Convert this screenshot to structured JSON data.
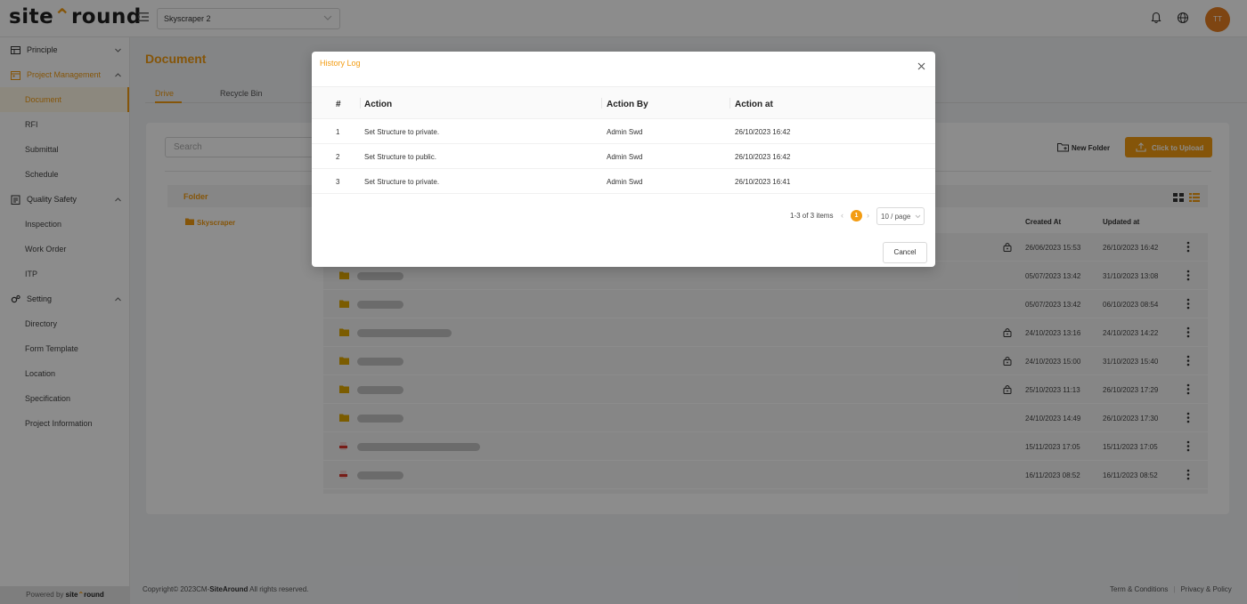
{
  "header": {
    "logo_part1": "site",
    "logo_part2": "round",
    "project": "Skyscraper 2",
    "avatar_initials": "TT"
  },
  "sidebar": {
    "groups": [
      {
        "label": "Principle",
        "icon": "table-icon"
      },
      {
        "label": "Project Management",
        "icon": "calendar-icon",
        "items": [
          "Document",
          "RFI",
          "Submittal",
          "Schedule"
        ]
      },
      {
        "label": "Quality Safety",
        "icon": "clipboard-icon",
        "items": [
          "Inspection",
          "Work Order",
          "ITP"
        ]
      },
      {
        "label": "Setting",
        "icon": "gears-icon",
        "items": [
          "Directory",
          "Form Template",
          "Location",
          "Specification",
          "Project Information"
        ]
      }
    ],
    "selected_item": "Document",
    "powered_by": "Powered by",
    "powered_logo_1": "site",
    "powered_logo_2": "round"
  },
  "page": {
    "title": "Document",
    "tabs": [
      "Drive",
      "Recycle Bin"
    ],
    "active_tab": "Drive"
  },
  "drive": {
    "search_placeholder": "Search",
    "new_folder_label": "New Folder",
    "upload_label": "Click to Upload",
    "folder_header": "Folder",
    "tree_item": "Skyscraper",
    "columns": {
      "created": "Created At",
      "updated": "Updated at"
    },
    "rows": [
      {
        "type": "folder",
        "locked": true,
        "created": "26/06/2023 15:53",
        "updated": "26/10/2023 16:42"
      },
      {
        "type": "folder",
        "locked": false,
        "created": "05/07/2023 13:42",
        "updated": "31/10/2023 13:08"
      },
      {
        "type": "folder",
        "locked": false,
        "created": "05/07/2023 13:42",
        "updated": "06/10/2023 08:54"
      },
      {
        "type": "folder",
        "locked": true,
        "created": "24/10/2023 13:16",
        "updated": "24/10/2023 14:22"
      },
      {
        "type": "folder",
        "locked": true,
        "created": "24/10/2023 15:00",
        "updated": "31/10/2023 15:40"
      },
      {
        "type": "folder",
        "locked": true,
        "created": "25/10/2023 11:13",
        "updated": "26/10/2023 17:29"
      },
      {
        "type": "folder",
        "locked": false,
        "created": "24/10/2023 14:49",
        "updated": "26/10/2023 17:30"
      },
      {
        "type": "pdf",
        "locked": false,
        "created": "15/11/2023 17:05",
        "updated": "15/11/2023 17:05"
      },
      {
        "type": "pdf",
        "locked": false,
        "created": "16/11/2023 08:52",
        "updated": "16/11/2023 08:52"
      }
    ]
  },
  "footer": {
    "copyright_pre": "Copyright© 2023CM-",
    "copyright_brand": "SiteAround",
    "copyright_post": " All rights reserved.",
    "terms": "Term & Conditions",
    "separator": "|",
    "privacy": "Privacy & Policy"
  },
  "modal": {
    "title": "History Log",
    "columns": {
      "num": "#",
      "action": "Action",
      "by": "Action By",
      "at": "Action at"
    },
    "rows": [
      {
        "num": "1",
        "action": "Set Structure to private.",
        "by": "Admin Swd",
        "at": "26/10/2023 16:42"
      },
      {
        "num": "2",
        "action": "Set Structure to public.",
        "by": "Admin Swd",
        "at": "26/10/2023 16:42"
      },
      {
        "num": "3",
        "action": "Set Structure to private.",
        "by": "Admin Swd",
        "at": "26/10/2023 16:41"
      }
    ],
    "pagination": {
      "total": "1-3 of 3 items",
      "current_page": "1",
      "page_size": "10 / page"
    },
    "cancel_label": "Cancel"
  },
  "colors": {
    "accent": "#f39c12",
    "overlay": "rgba(0,0,0,0.45)"
  }
}
